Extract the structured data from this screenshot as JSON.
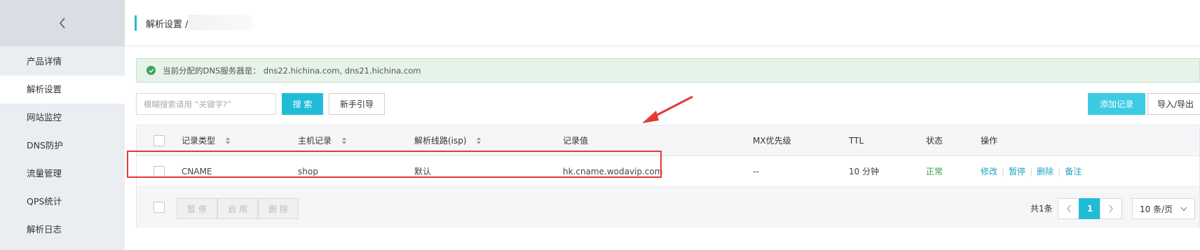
{
  "sidebar": {
    "back_icon": "chevron-left-icon",
    "items": [
      {
        "label": "产品详情",
        "active": false
      },
      {
        "label": "解析设置",
        "active": true
      },
      {
        "label": "网站监控",
        "active": false
      },
      {
        "label": "DNS防护",
        "active": false
      },
      {
        "label": "流量管理",
        "active": false
      },
      {
        "label": "QPS统计",
        "active": false
      },
      {
        "label": "解析日志",
        "active": false
      }
    ]
  },
  "header": {
    "title": "解析设置 /"
  },
  "info": {
    "icon": "check-circle-icon",
    "text": "当前分配的DNS服务器是：",
    "servers": "dns22.hichina.com, dns21.hichina.com"
  },
  "toolbar": {
    "search_placeholder": "模糊搜索请用 “关键字?”",
    "search_label": "搜 索",
    "guide_label": "新手引导",
    "add_label": "添加记录",
    "import_label": "导入/导出"
  },
  "table": {
    "columns": [
      "记录类型",
      "主机记录",
      "解析线路(isp)",
      "记录值",
      "MX优先级",
      "TTL",
      "状态",
      "操作"
    ],
    "rows": [
      {
        "type": "CNAME",
        "host": "shop",
        "line": "默认",
        "value": "hk.cname.wodavip.com",
        "mx": "--",
        "ttl": "10 分钟",
        "status": "正常",
        "actions": [
          "修改",
          "暂停",
          "删除",
          "备注"
        ]
      }
    ]
  },
  "footer": {
    "pause_label": "暂 停",
    "enable_label": "启 用",
    "delete_label": "删 除",
    "total": "共1条",
    "current_page": "1",
    "page_size": "10 条/页"
  },
  "colors": {
    "accent": "#20bcd6",
    "status_ok": "#2f9e44",
    "annotation": "#e53935"
  }
}
